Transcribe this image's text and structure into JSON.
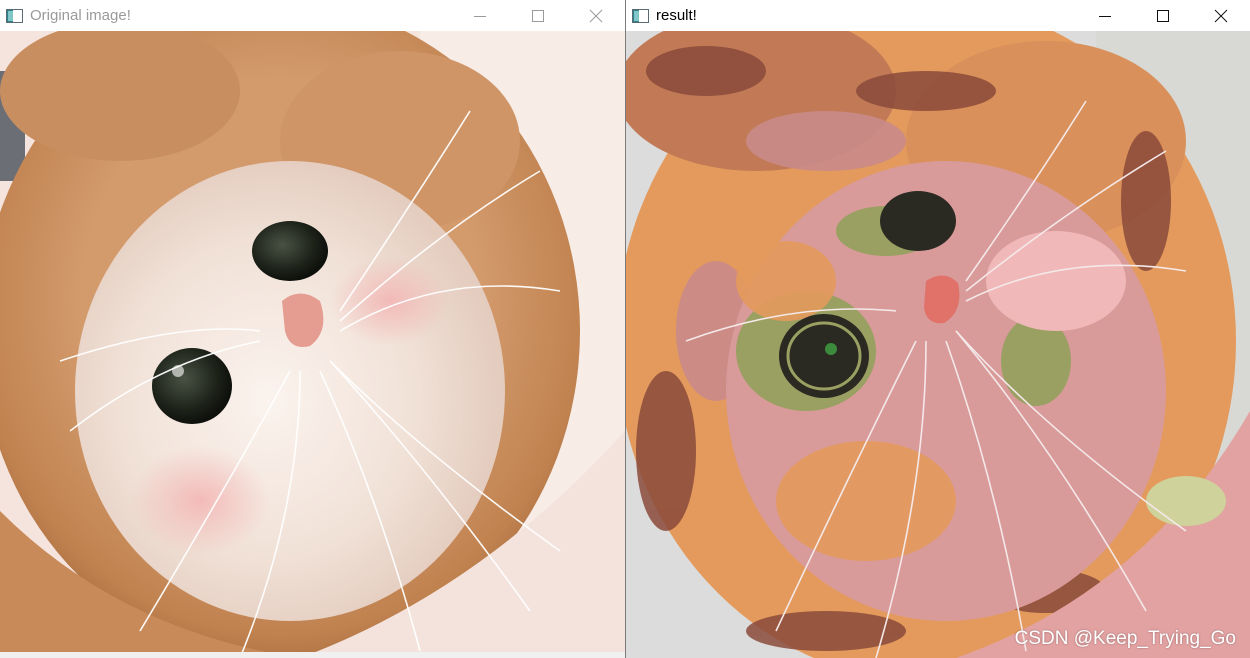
{
  "windows": {
    "original": {
      "title": "Original image!",
      "icon": "opencv-window-icon"
    },
    "result": {
      "title": "result!",
      "icon": "opencv-window-icon"
    }
  },
  "controls": {
    "minimize": "minimize-icon",
    "maximize": "maximize-icon",
    "close": "close-icon"
  },
  "watermark": "CSDN @Keep_Trying_Go",
  "colors": {
    "fur_light": "#f3e1d8",
    "fur_hat": "#c98a5a",
    "fur_hat_dark": "#9c5e37",
    "quant_pink": "#d99a9a",
    "quant_orange": "#e39a5c",
    "quant_olive": "#9aa062",
    "quant_brown": "#8a4a3a",
    "quant_dark": "#2a2a22"
  }
}
